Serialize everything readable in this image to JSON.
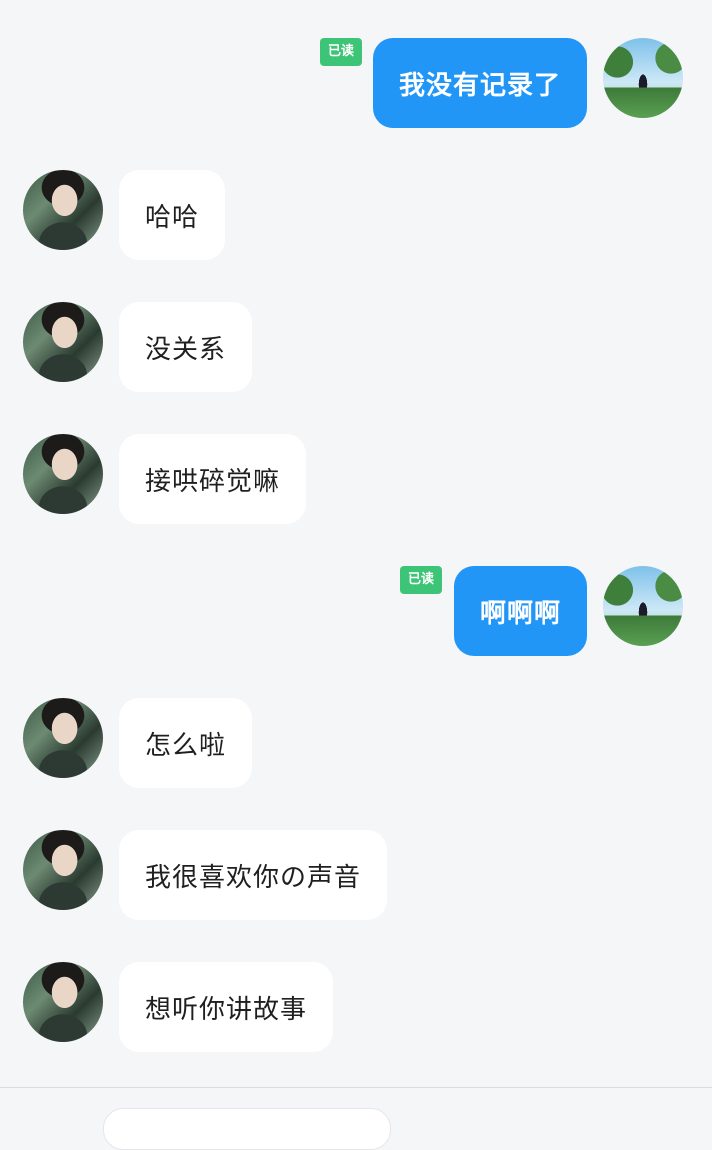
{
  "read_label": "已读",
  "messages": [
    {
      "side": "right",
      "text": "我没有记录了",
      "read": true
    },
    {
      "side": "left",
      "text": "哈哈"
    },
    {
      "side": "left",
      "text": "没关系"
    },
    {
      "side": "left",
      "text": "接哄碎觉嘛"
    },
    {
      "side": "right",
      "text": "啊啊啊",
      "read": true
    },
    {
      "side": "left",
      "text": "怎么啦"
    },
    {
      "side": "left",
      "text": "我很喜欢你の声音"
    },
    {
      "side": "left",
      "text": "想听你讲故事"
    }
  ],
  "colors": {
    "background": "#f5f6f8",
    "sent_bubble": "#2196f7",
    "received_bubble": "#ffffff",
    "read_badge": "#3dc476"
  }
}
